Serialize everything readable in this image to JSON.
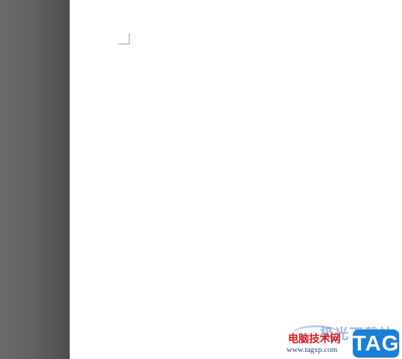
{
  "editor": {
    "document": {
      "body_text": ""
    }
  },
  "watermark": {
    "faint_text": "极光下载站",
    "site_name_cn": "电脑技术网",
    "url": "www.tagxp.com",
    "badge": "TAG",
    "colors": {
      "site_name": "#d8181e",
      "url": "#1f3f8f",
      "badge_bg": "#1a7fd8"
    }
  }
}
